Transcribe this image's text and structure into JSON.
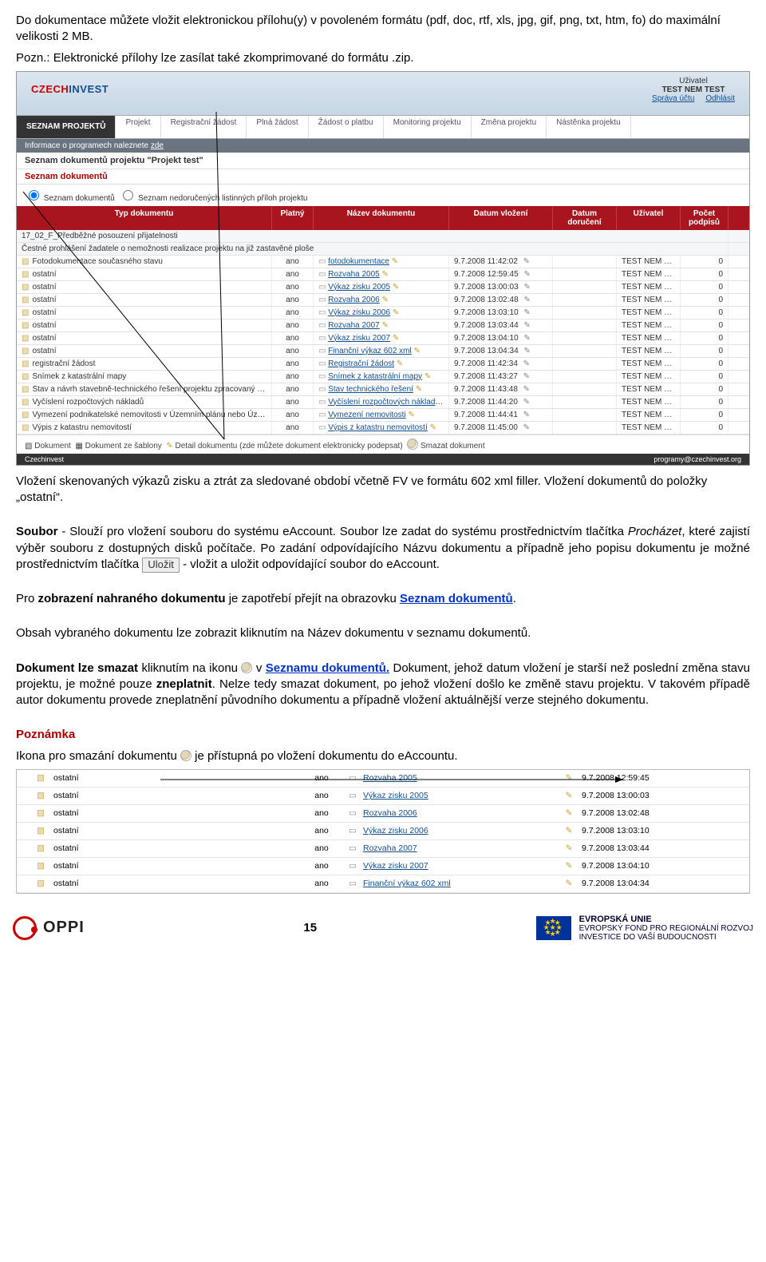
{
  "intro": {
    "p1": "Do dokumentace můžete vložit elektronickou přílohu(y) v povoleném formátu (pdf, doc, rtf, xls, jpg, gif, png, txt, htm, fo) do maximální velikosti 2 MB.",
    "p2": "Pozn.: Elektronické přílohy lze zasílat také zkomprimované do formátu .zip."
  },
  "shot1": {
    "logo_left": "CZECH",
    "logo_right": "INVEST",
    "user_label": "Uživatel",
    "user_name": "TEST NEM TEST",
    "link_account": "Správa účtu",
    "link_logout": "Odhlásit",
    "tabs": [
      "SEZNAM PROJEKTŮ",
      "Projekt",
      "Registrační žádost",
      "Plná žádost",
      "Žádost o platbu",
      "Monitoring projektu",
      "Změna projektu",
      "Nástěnka projektu"
    ],
    "infobar_pre": "Informace o programech naleznete ",
    "infobar_link": "zde",
    "title": "Seznam dokumentů projektu \"Projekt test\"",
    "subtitle": "Seznam dokumentů",
    "radio1": "Seznam dokumentů",
    "radio2": "Seznam nedoručených listinných příloh projektu",
    "th": [
      "Typ dokumentu",
      "Platný",
      "Název dokumentu",
      "Datum vložení",
      "Datum doručení",
      "Uživatel",
      "Počet podpisů"
    ],
    "pre_rows": [
      "17_02_F_Předběžné posouzení přijatelnosti",
      "Čestné prohlášení žadatele o nemožnosti realizace projektu na již zastavěné ploše"
    ],
    "rows": [
      {
        "typ": "Fotodokumentace současného stavu",
        "platny": "ano",
        "nazev": "fotodokumentace",
        "datum": "9.7.2008 11:42:02",
        "uziv": "TEST NEM TEST",
        "pocet": "0"
      },
      {
        "typ": "ostatní",
        "platny": "ano",
        "nazev": "Rozvaha 2005",
        "datum": "9.7.2008 12:59:45",
        "uziv": "TEST NEM TEST",
        "pocet": "0"
      },
      {
        "typ": "ostatní",
        "platny": "ano",
        "nazev": "Výkaz zisku 2005",
        "datum": "9.7.2008 13:00:03",
        "uziv": "TEST NEM TEST",
        "pocet": "0"
      },
      {
        "typ": "ostatní",
        "platny": "ano",
        "nazev": "Rozvaha 2006",
        "datum": "9.7.2008 13:02:48",
        "uziv": "TEST NEM TEST",
        "pocet": "0"
      },
      {
        "typ": "ostatní",
        "platny": "ano",
        "nazev": "Výkaz zisku 2006",
        "datum": "9.7.2008 13:03:10",
        "uziv": "TEST NEM TEST",
        "pocet": "0"
      },
      {
        "typ": "ostatní",
        "platny": "ano",
        "nazev": "Rozvaha 2007",
        "datum": "9.7.2008 13:03:44",
        "uziv": "TEST NEM TEST",
        "pocet": "0"
      },
      {
        "typ": "ostatní",
        "platny": "ano",
        "nazev": "Výkaz zisku 2007",
        "datum": "9.7.2008 13:04:10",
        "uziv": "TEST NEM TEST",
        "pocet": "0"
      },
      {
        "typ": "ostatní",
        "platny": "ano",
        "nazev": "Finanční výkaz 602 xml",
        "datum": "9.7.2008 13:04:34",
        "uziv": "TEST NEM TEST",
        "pocet": "0"
      },
      {
        "typ": "registrační žádost",
        "platny": "ano",
        "nazev": "Registrační žádost",
        "datum": "9.7.2008 11:42:34",
        "uziv": "TEST NEM TEST",
        "pocet": "0"
      },
      {
        "typ": "Snímek z katastrální mapy",
        "platny": "ano",
        "nazev": "Snímek z katastrální mapy",
        "datum": "9.7.2008 11:43:27",
        "uziv": "TEST NEM TEST",
        "pocet": "0"
      },
      {
        "typ": "Stav a návrh stavebně-technického řešení projektu zpracovaný odborně způsobilou osobou - situační výkres na podkladě katastrální mapy",
        "platny": "ano",
        "nazev": "Stav technického řešení",
        "datum": "9.7.2008 11:43:48",
        "uziv": "TEST NEM TEST",
        "pocet": "0"
      },
      {
        "typ": "Vyčíslení rozpočtových nákladů",
        "platny": "ano",
        "nazev": "Vyčíslení rozpočtových nákladů",
        "datum": "9.7.2008 11:44:20",
        "uziv": "TEST NEM TEST",
        "pocet": "0"
      },
      {
        "typ": "Vymezení podnikatelské nemovitosti v Územním plánu nebo Územní rozhodnutí",
        "platny": "ano",
        "nazev": "Vymezení nemovitosti",
        "datum": "9.7.2008 11:44:41",
        "uziv": "TEST NEM TEST",
        "pocet": "0"
      },
      {
        "typ": "Výpis z katastru nemovitostí",
        "platny": "ano",
        "nazev": "Výpis z katastru nemovitostí",
        "datum": "9.7.2008 11:45:00",
        "uziv": "TEST NEM TEST",
        "pocet": "0"
      }
    ],
    "legend": [
      "Dokument",
      "Dokument ze šablony",
      "Detail dokumentu (zde můžete dokument elektronicky podepsat)",
      "Smazat dokument"
    ],
    "foot_left": "Czechinvest",
    "foot_right": "programy@czechinvest.org"
  },
  "mid": {
    "p1": "Vložení skenovaných výkazů zisku a ztrát za sledované období včetně FV ve formátu 602 xml filler. Vložení dokumentů do položky „ostatní“.",
    "p2a_bold": "Soubor",
    "p2a": " - Slouží pro vložení souboru do systému eAccount. Soubor lze zadat do systému prostřednictvím tlačítka ",
    "p2a_it": "Procházet",
    "p2a2": ", které zajistí výběr souboru z dostupných disků počítače. Po zadání odpovídajícího Názvu dokumentu a případně jeho popisu dokumentu je možné prostřednictvím tlačítka ",
    "btn": "Uložit",
    "p2a3": " - vložit a uložit odpovídající soubor do eAccount.",
    "p3a": "Pro ",
    "p3b": "zobrazení nahraného dokumentu",
    "p3c": " je zapotřebí přejít na obrazovku ",
    "p3link": "Seznam dokumentů",
    "p3d": ".",
    "p4": "Obsah vybraného dokumentu lze zobrazit kliknutím na Název dokumentu v seznamu dokumentů.",
    "p5a": "Dokument lze smazat",
    "p5b": " kliknutím na ikonu ",
    "p5c": "v ",
    "p5link": "Seznamu dokumentů.",
    "p5d": " Dokument, jehož datum vložení je starší než poslední změna stavu projektu, je možné pouze ",
    "p5e": "zneplatnit",
    "p5f": ". Nelze tedy smazat dokument, po jehož vložení došlo ke změně stavu projektu. V takovém případě autor dokumentu provede zneplatnění původního dokumentu a případně vložení aktuálnější verze stejného dokumentu.",
    "pozn_h": "Poznámka",
    "pozn_a": "Ikona pro smazání dokumentu ",
    "pozn_b": "je přístupná po vložení dokumentu do eAccountu."
  },
  "shot2": {
    "rows": [
      {
        "typ": "ostatní",
        "platny": "ano",
        "nazev": "Rozvaha 2005",
        "datum": "9.7.2008 12:59:45"
      },
      {
        "typ": "ostatní",
        "platny": "ano",
        "nazev": "Výkaz zisku 2005",
        "datum": "9.7.2008 13:00:03"
      },
      {
        "typ": "ostatní",
        "platny": "ano",
        "nazev": "Rozvaha 2006",
        "datum": "9.7.2008 13:02:48"
      },
      {
        "typ": "ostatní",
        "platny": "ano",
        "nazev": "Výkaz zisku 2006",
        "datum": "9.7.2008 13:03:10"
      },
      {
        "typ": "ostatní",
        "platny": "ano",
        "nazev": "Rozvaha 2007",
        "datum": "9.7.2008 13:03:44"
      },
      {
        "typ": "ostatní",
        "platny": "ano",
        "nazev": "Výkaz zisku 2007",
        "datum": "9.7.2008 13:04:10"
      },
      {
        "typ": "ostatní",
        "platny": "ano",
        "nazev": "Finanční výkaz 602 xml",
        "datum": "9.7.2008 13:04:34"
      }
    ]
  },
  "footer": {
    "oppi": "OPPI",
    "pagenum": "15",
    "eu1": "EVROPSKÁ UNIE",
    "eu2": "EVROPSKÝ FOND PRO REGIONÁLNÍ ROZVOJ",
    "eu3": "INVESTICE DO VAŠÍ BUDOUCNOSTI"
  }
}
